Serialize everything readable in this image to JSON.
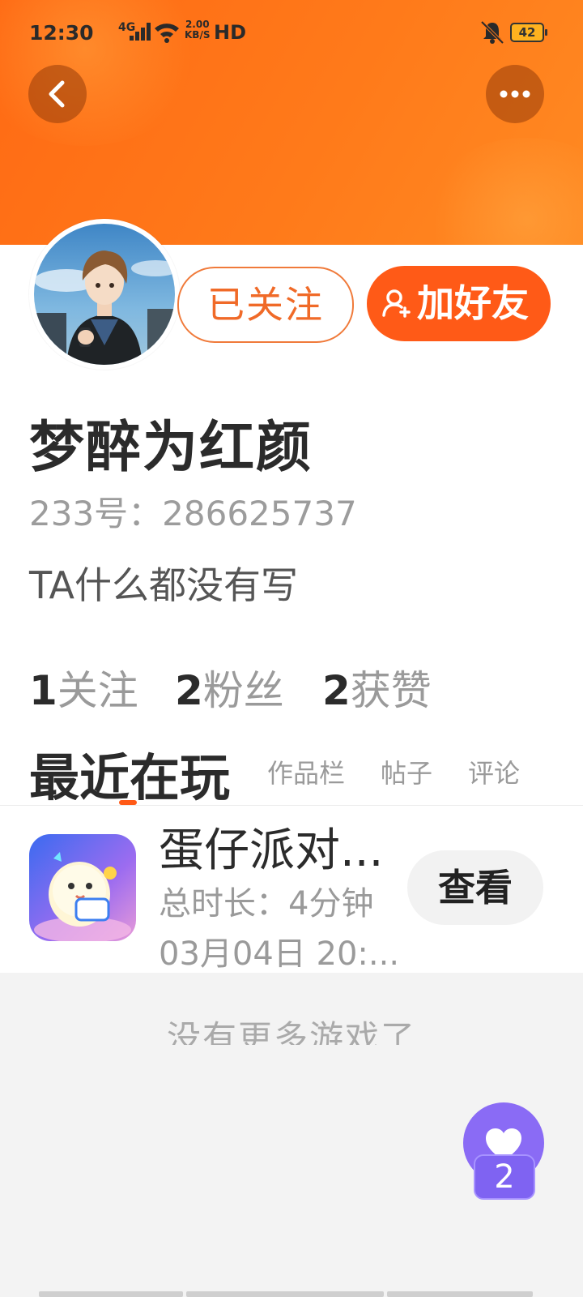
{
  "status_bar": {
    "time": "12:30",
    "network": "4G",
    "speed_value": "2.00",
    "speed_unit": "KB/S",
    "hd": "HD",
    "battery": "42"
  },
  "profile": {
    "follow_state_label": "已关注",
    "add_friend_label": "加好友",
    "name": "梦醉为红颜",
    "id_text": "233号：286625737",
    "bio": "TA什么都没有写",
    "stats": [
      {
        "count": "1",
        "label": "关注"
      },
      {
        "count": "2",
        "label": "粉丝"
      },
      {
        "count": "2",
        "label": "获赞"
      }
    ]
  },
  "tabs": {
    "active": "最近在玩",
    "others": [
      "作品栏",
      "帖子",
      "评论"
    ]
  },
  "recent_games": [
    {
      "title": "蛋仔派对...",
      "duration": "总时长：4分钟",
      "date": "03月04日 20:...",
      "action": "查看"
    }
  ],
  "no_more_text": "没有更多游戏了",
  "like_fab": {
    "count": "2"
  },
  "colors": {
    "accent": "#ff5a17",
    "header": "#ff7a1a",
    "like": "#8a6bf5"
  }
}
